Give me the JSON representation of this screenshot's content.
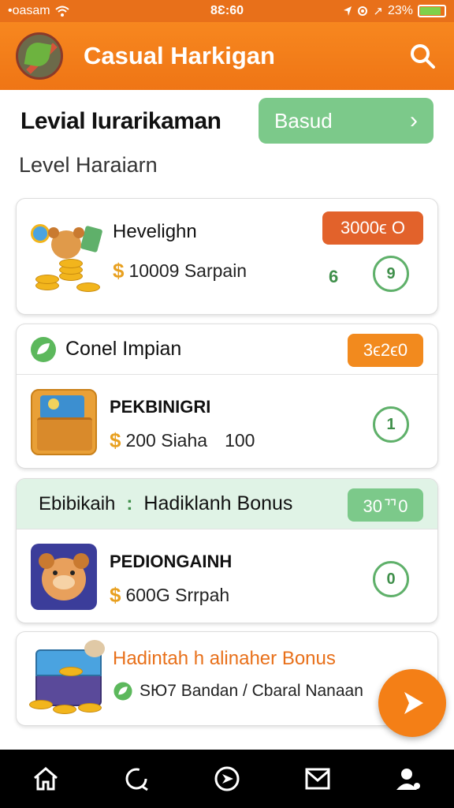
{
  "status_bar": {
    "carrier": "•oasam",
    "time": "8Ɛ:60",
    "battery": "23%",
    "battery_level": 0.85
  },
  "app_bar": {
    "title": "Casual Harkigan",
    "search_icon": "search-icon"
  },
  "level": {
    "title": "Levial Iurarikaman",
    "button_label": "Basud",
    "subtitle": "Level Haraiarn"
  },
  "cards": [
    {
      "name": "Hevelighn",
      "badge": "3000ϵ O",
      "amount": "10009 Sarpain",
      "count": "6",
      "circle": "9",
      "badge_color": "#e2622b"
    },
    {
      "header": "Conel Impian",
      "header_badge": "3ϵ2ϵ0",
      "name": "PEKBINIGRI",
      "amount": "200 Siaha",
      "amount_extra": "100",
      "circle": "1",
      "badge_color": "#f28a1e"
    },
    {
      "header_left": "Ebibikaih",
      "header_sep": ":",
      "header_right": "Hadiklanh Bonus",
      "header_badge": "30ᄁ0",
      "name": "PEDIONGAINH",
      "amount": "600G Srrpah",
      "circle": "0",
      "badge_color": "#7cc98a"
    },
    {
      "title": "Hadintah h alinaher Bonus",
      "subtitle": "SЮ7 Bandan / Cbaral Nanaan"
    }
  ],
  "nav": [
    {
      "icon": "home-icon"
    },
    {
      "icon": "refresh-icon"
    },
    {
      "icon": "play-circle-icon"
    },
    {
      "icon": "mail-icon"
    },
    {
      "icon": "profile-icon"
    }
  ],
  "colors": {
    "accent": "#f47f16",
    "green": "#7cc98a",
    "coin": "#f2b51c"
  }
}
